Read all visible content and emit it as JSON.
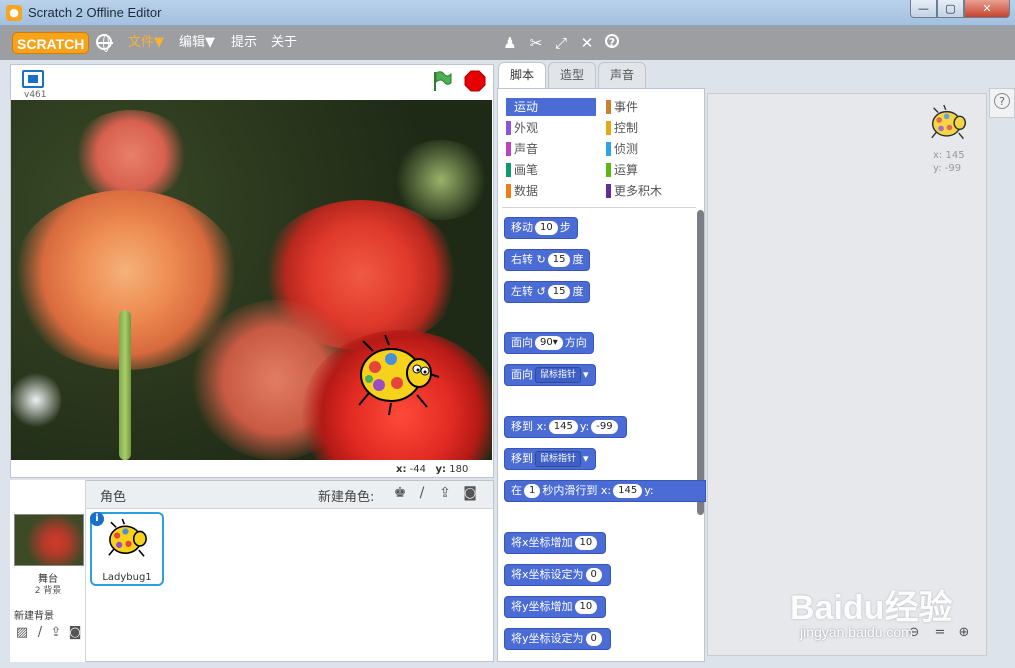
{
  "window": {
    "title": "Scratch 2 Offline Editor",
    "min": "0",
    "max": "1",
    "close": "r"
  },
  "menubar": {
    "logo": "SCRATCH",
    "items": [
      "文件▼",
      "编辑▼",
      "提示",
      "关于"
    ],
    "tools": [
      "duplicate-icon",
      "delete-icon",
      "grow-icon",
      "shrink-icon",
      "help-icon"
    ]
  },
  "stage": {
    "version": "v461",
    "mouse_x_label": "x:",
    "mouse_x": "-44",
    "mouse_y_label": "y:",
    "mouse_y": "180"
  },
  "sprites": {
    "label": "角色",
    "new_sprite_label": "新建角色:",
    "stage_name": "舞台",
    "backdrop_count": "2 背景",
    "new_backdrop_label": "新建背景",
    "list": [
      {
        "name": "Ladybug1"
      }
    ]
  },
  "tabs": [
    "脚本",
    "造型",
    "声音"
  ],
  "categories": [
    {
      "label": "运动",
      "color": "#4a6cd4"
    },
    {
      "label": "事件",
      "color": "#c88330"
    },
    {
      "label": "外观",
      "color": "#8a55d7"
    },
    {
      "label": "控制",
      "color": "#e1a91a"
    },
    {
      "label": "声音",
      "color": "#bb42c3"
    },
    {
      "label": "侦测",
      "color": "#2ca5e2"
    },
    {
      "label": "画笔",
      "color": "#0e9a6c"
    },
    {
      "label": "运算",
      "color": "#5cb712"
    },
    {
      "label": "数据",
      "color": "#ee7d16"
    },
    {
      "label": "更多积木",
      "color": "#632d99"
    }
  ],
  "blocks": {
    "move": {
      "a": "移动",
      "v": "10",
      "b": "步"
    },
    "turn_right": {
      "a": "右转",
      "v": "15",
      "b": "度"
    },
    "turn_left": {
      "a": "左转",
      "v": "15",
      "b": "度"
    },
    "point_dir": {
      "a": "面向",
      "v": "90▾",
      "b": "方向"
    },
    "point_towards": {
      "a": "面向",
      "v": "鼠标指针"
    },
    "goto_xy": {
      "a": "移到 x:",
      "x": "145",
      "b": "y:",
      "y": "-99"
    },
    "goto": {
      "a": "移到",
      "v": "鼠标指针"
    },
    "glide": {
      "a": "在",
      "v": "1",
      "b": "秒内滑行到 x:",
      "x": "145",
      "c": "y:"
    },
    "change_x": {
      "a": "将x坐标增加",
      "v": "10"
    },
    "set_x": {
      "a": "将x坐标设定为",
      "v": "0"
    },
    "change_y": {
      "a": "将y坐标增加",
      "v": "10"
    },
    "set_y": {
      "a": "将y坐标设定为",
      "v": "0"
    }
  },
  "scripts_area": {
    "sprite_x": "x: 145",
    "sprite_y": "y: -99"
  },
  "watermark": {
    "text": "Baidu经验",
    "url": "jingyan.baidu.com"
  }
}
